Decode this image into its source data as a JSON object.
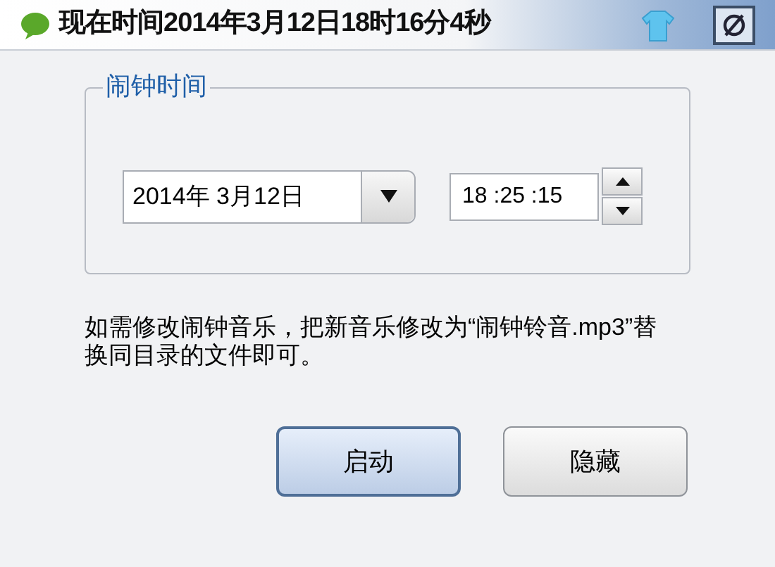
{
  "window": {
    "title": "现在时间2014年3月12日18时16分4秒"
  },
  "alarm_group": {
    "title": "闹钟时间",
    "date": "2014年 3月12日",
    "time": "18 :25 :15"
  },
  "note": "如需修改闹钟音乐，把新音乐修改为“闹钟铃音.mp3”替换同目录的文件即可。",
  "buttons": [
    {
      "label": "启动",
      "default": true
    },
    {
      "label": "隐藏",
      "default": false
    }
  ]
}
